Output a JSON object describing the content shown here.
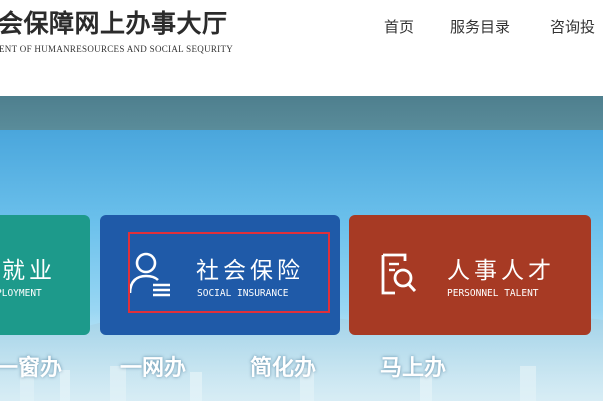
{
  "header": {
    "title": "会保障网上办事大厅",
    "subtitle": "ENT OF HUMANRESOURCES AND SOCIAL SEQURITY"
  },
  "nav": {
    "items": [
      {
        "label": "首页"
      },
      {
        "label": "服务目录"
      },
      {
        "label": "咨询投"
      }
    ]
  },
  "cards": {
    "employment": {
      "title": "就业",
      "subtitle": "PLOYMENT",
      "color": "#1d9a8b"
    },
    "social_insurance": {
      "title": "社会保险",
      "subtitle": "SOCIAL INSURANCE",
      "color": "#1f5aa8",
      "icon": "person-card-icon"
    },
    "personnel_talent": {
      "title": "人事人才",
      "subtitle": "PERSONNEL TALENT",
      "color": "#a73a24",
      "icon": "document-search-icon"
    }
  },
  "slogans": [
    "一窗办",
    "一网办",
    "简化办",
    "马上办"
  ],
  "colors": {
    "highlight_box": "#e0303a",
    "banner_strip": "#4e7f8e"
  }
}
